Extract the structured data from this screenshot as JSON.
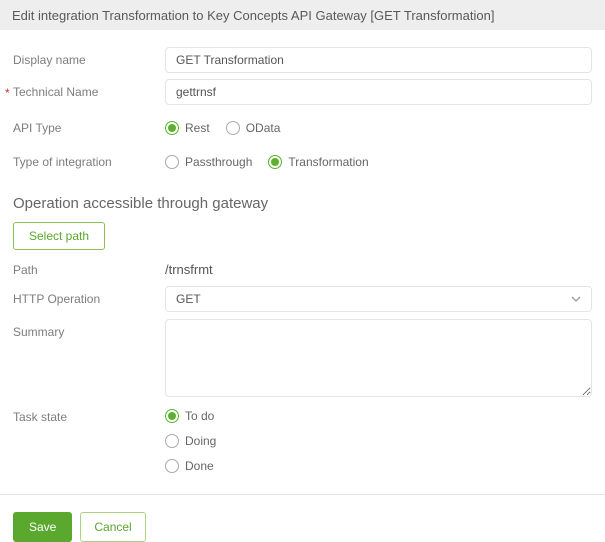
{
  "header": {
    "title": "Edit integration Transformation to Key Concepts API Gateway [GET Transformation]"
  },
  "form": {
    "display_name": {
      "label": "Display name",
      "value": "GET Transformation"
    },
    "technical_name": {
      "label": "Technical Name",
      "required_marker": "*",
      "value": "gettrnsf"
    },
    "api_type": {
      "label": "API Type",
      "options": [
        {
          "label": "Rest",
          "selected": true
        },
        {
          "label": "OData",
          "selected": false
        }
      ]
    },
    "integration_type": {
      "label": "Type of integration",
      "options": [
        {
          "label": "Passthrough",
          "selected": false
        },
        {
          "label": "Transformation",
          "selected": true
        }
      ]
    },
    "section_heading": "Operation accessible through gateway",
    "select_path_button": "Select path",
    "path": {
      "label": "Path",
      "value": "/trnsfrmt"
    },
    "http_operation": {
      "label": "HTTP Operation",
      "value": "GET"
    },
    "summary": {
      "label": "Summary",
      "value": ""
    },
    "task_state": {
      "label": "Task state",
      "options": [
        {
          "label": "To do",
          "selected": true
        },
        {
          "label": "Doing",
          "selected": false
        },
        {
          "label": "Done",
          "selected": false
        }
      ]
    },
    "actions": {
      "save": "Save",
      "cancel": "Cancel"
    }
  },
  "colors": {
    "accent_green": "#5aa82e",
    "radio_green": "#5cb230",
    "required_red": "#cc3333",
    "header_bg": "#efeeee"
  }
}
